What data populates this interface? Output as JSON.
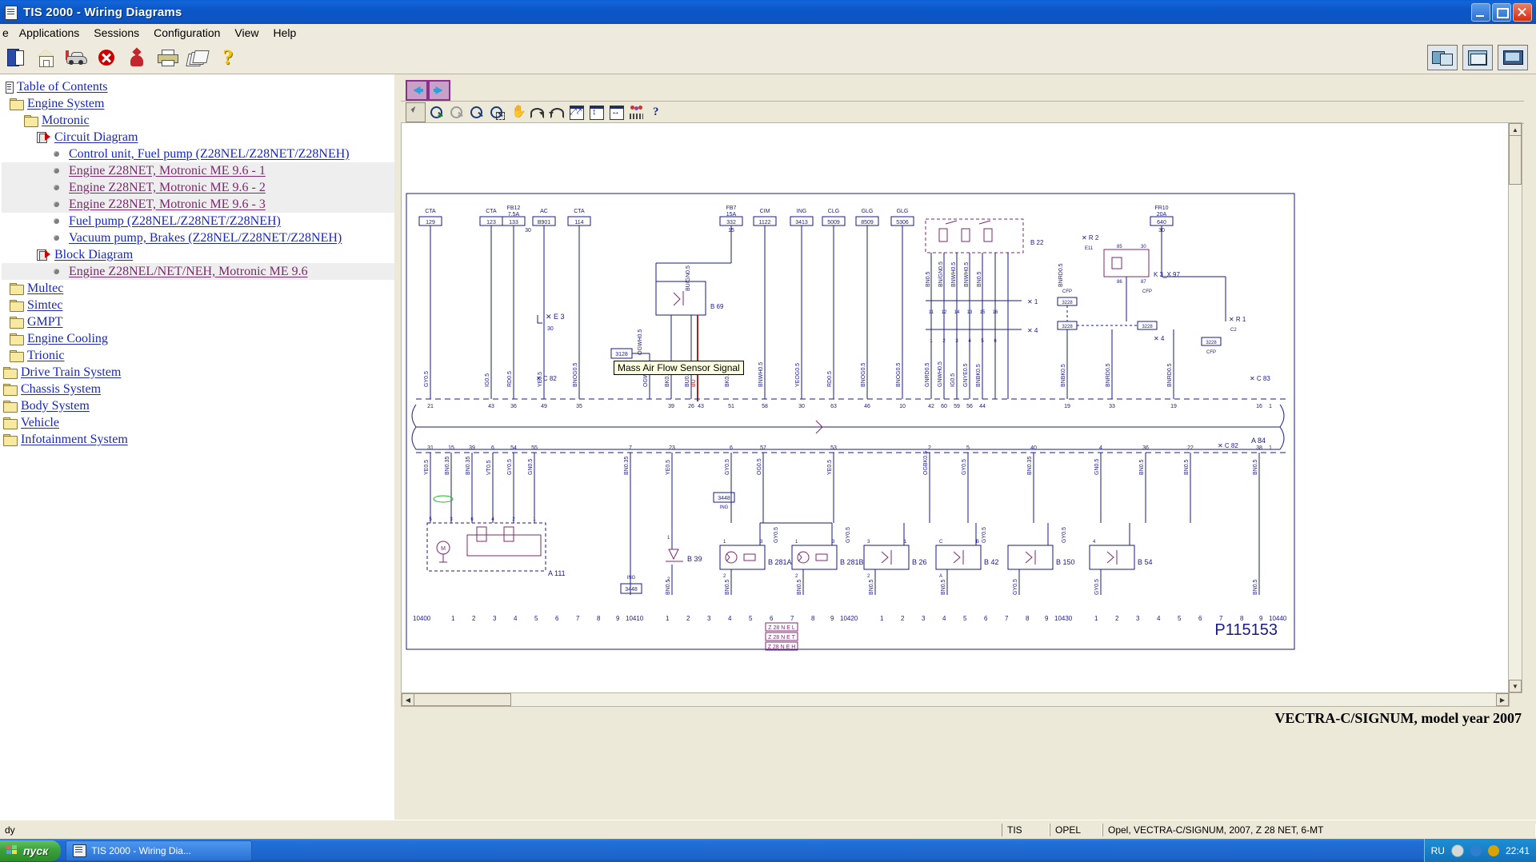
{
  "window": {
    "title": "TIS 2000 - Wiring Diagrams",
    "icon": "document-icon",
    "minimize": "minimize-icon",
    "maximize": "maximize-icon",
    "close": "close-icon"
  },
  "menubar": {
    "items": [
      {
        "label": "e",
        "name": "menu-file-clipped"
      },
      {
        "label": "Applications",
        "name": "menu-applications"
      },
      {
        "label": "Sessions",
        "name": "menu-sessions"
      },
      {
        "label": "Configuration",
        "name": "menu-configuration"
      },
      {
        "label": "View",
        "name": "menu-view"
      },
      {
        "label": "Help",
        "name": "menu-help"
      }
    ]
  },
  "toolbar": {
    "buttons": [
      {
        "name": "open-document-icon",
        "tip": "Open"
      },
      {
        "name": "home-icon",
        "tip": "Home"
      },
      {
        "name": "vehicle-icon",
        "tip": "Vehicle identification"
      },
      {
        "name": "stop-icon",
        "tip": "Stop"
      },
      {
        "name": "person-icon",
        "tip": "User"
      },
      {
        "name": "print-icon",
        "tip": "Print"
      },
      {
        "name": "pages-icon",
        "tip": "Documents"
      },
      {
        "name": "help-icon",
        "tip": "Help"
      }
    ],
    "right_buttons": [
      {
        "name": "window-tile-icon"
      },
      {
        "name": "window-cascade-icon"
      },
      {
        "name": "window-monitor-icon"
      }
    ]
  },
  "sidebar": {
    "items": [
      {
        "label": "Table of Contents",
        "indent": 0,
        "icon": "toc-icon",
        "visited": false
      },
      {
        "label": "Engine System",
        "indent": 1,
        "icon": "folder-icon",
        "visited": false
      },
      {
        "label": "Motronic",
        "indent": 2,
        "icon": "folder-icon",
        "visited": false
      },
      {
        "label": "Circuit Diagram",
        "indent": 3,
        "icon": "document-arrow-icon",
        "visited": false
      },
      {
        "label": "Control unit, Fuel pump (Z28NEL/Z28NET/Z28NEH)",
        "indent": 4,
        "icon": "bullet-icon",
        "visited": false
      },
      {
        "label": "Engine Z28NET, Motronic ME 9.6 - 1",
        "indent": 4,
        "icon": "bullet-icon",
        "visited": true
      },
      {
        "label": "Engine Z28NET, Motronic ME 9.6 - 2",
        "indent": 4,
        "icon": "bullet-icon",
        "visited": true
      },
      {
        "label": "Engine Z28NET, Motronic ME 9.6 - 3",
        "indent": 4,
        "icon": "bullet-icon",
        "visited": true
      },
      {
        "label": "Fuel pump (Z28NEL/Z28NET/Z28NEH)",
        "indent": 4,
        "icon": "bullet-icon",
        "visited": false
      },
      {
        "label": "Vacuum pump, Brakes (Z28NEL/Z28NET/Z28NEH)",
        "indent": 4,
        "icon": "bullet-icon",
        "visited": false
      },
      {
        "label": "Block Diagram",
        "indent": 3,
        "icon": "document-arrow-icon",
        "visited": false
      },
      {
        "label": "Engine Z28NEL/NET/NEH, Motronic ME 9.6",
        "indent": 4,
        "icon": "bullet-icon",
        "visited": true
      },
      {
        "label": "Multec",
        "indent": 2,
        "icon": "folder-icon",
        "visited": false
      },
      {
        "label": "Simtec",
        "indent": 2,
        "icon": "folder-icon",
        "visited": false
      },
      {
        "label": "GMPT",
        "indent": 2,
        "icon": "folder-icon",
        "visited": false
      },
      {
        "label": "Engine Cooling",
        "indent": 2,
        "icon": "folder-icon",
        "visited": false
      },
      {
        "label": "Trionic",
        "indent": 2,
        "icon": "folder-icon",
        "visited": false
      },
      {
        "label": "Drive Train System",
        "indent": 1,
        "icon": "folder-icon",
        "visited": false
      },
      {
        "label": "Chassis System",
        "indent": 1,
        "icon": "folder-icon",
        "visited": false
      },
      {
        "label": "Body System",
        "indent": 1,
        "icon": "folder-icon",
        "visited": false
      },
      {
        "label": "Vehicle",
        "indent": 1,
        "icon": "folder-icon",
        "visited": false
      },
      {
        "label": "Infotainment System",
        "indent": 1,
        "icon": "folder-icon",
        "visited": false
      }
    ]
  },
  "diagram_toolbar": {
    "nav": [
      {
        "name": "back-arrow-button"
      },
      {
        "name": "forward-arrow-button"
      }
    ],
    "tools": [
      {
        "name": "pointer-tool",
        "selected": true
      },
      {
        "name": "zoom-in-tool",
        "enabled": true
      },
      {
        "name": "zoom-out-tool",
        "enabled": false
      },
      {
        "name": "zoom-tool",
        "enabled": true
      },
      {
        "name": "zoom-region-tool",
        "enabled": true
      },
      {
        "name": "pan-hand-tool",
        "enabled": true
      },
      {
        "name": "rotate-cw-tool",
        "enabled": true
      },
      {
        "name": "rotate-ccw-tool",
        "enabled": true
      },
      {
        "name": "fit-page-tool",
        "enabled": true
      },
      {
        "name": "fit-height-tool",
        "enabled": true
      },
      {
        "name": "fit-width-tool",
        "enabled": true
      },
      {
        "name": "legend-tool",
        "enabled": true
      },
      {
        "name": "help-tool",
        "enabled": true
      }
    ]
  },
  "diagram": {
    "tooltip": "Mass Air Flow Sensor Signal",
    "drawing_number": "P115153",
    "caption": "VECTRA-C/SIGNUM, model year 2007",
    "fuses_top": [
      {
        "name": "CTA",
        "value": "129"
      },
      {
        "name": "CTA",
        "value": "123"
      },
      {
        "name": "FB12\n7.5A",
        "value": "133",
        "pin": "30"
      },
      {
        "name": "AC",
        "value": "B901"
      },
      {
        "name": "CTA",
        "value": "114"
      },
      {
        "name": "FB7\n15A",
        "value": "332",
        "pin": "15"
      },
      {
        "name": "CIM",
        "value": "1122"
      },
      {
        "name": "ING",
        "value": "3413"
      },
      {
        "name": "CLG",
        "value": "5009"
      },
      {
        "name": "GLG",
        "value": "8509"
      },
      {
        "name": "GLG",
        "value": "5306"
      },
      {
        "name": "FR10\n20A",
        "value": "640",
        "pin": "30"
      }
    ],
    "wire_labels_top": [
      "GY0.5",
      "IG0.5",
      "RD0.5",
      "YE0.5",
      "BN0.5",
      "OGWH0.5",
      "BK0.5",
      "BU0.5",
      "BK0.5",
      "BNWH0.5",
      "YEOG0.5",
      "RD0.5",
      "BNOG0.5",
      "GNRD0.5",
      "GNWH0.5",
      "IG0.5",
      "GNYE0.5",
      "BNBK0.5",
      "BNBK0.5",
      "BNRD0.5"
    ],
    "connectors": [
      "X E 3",
      "X C 82",
      "X C 83",
      "X 1",
      "X 4",
      "X R 2",
      "X R 1",
      "X 4"
    ],
    "components": [
      {
        "id": "B 69"
      },
      {
        "id": "B 22"
      },
      {
        "id": "K 3_X 97"
      },
      {
        "id": "A 84"
      },
      {
        "id": "A 111"
      },
      {
        "id": "B 39"
      },
      {
        "id": "B 281A"
      },
      {
        "id": "B 281B"
      },
      {
        "id": "B 26"
      },
      {
        "id": "B 42"
      },
      {
        "id": "B 150"
      },
      {
        "id": "B 54"
      }
    ],
    "ruler_groups": [
      "10400",
      "10410",
      "10420",
      "10430",
      "10440"
    ],
    "ruler_ticks": [
      "1",
      "2",
      "3",
      "4",
      "5",
      "6",
      "7",
      "8",
      "9"
    ],
    "footer_codes": [
      "Z 28 N E L",
      "Z 28 N E T",
      "Z 28 N E H"
    ],
    "bottom_wire_labels": [
      "YE0.5",
      "BN0.5",
      "BN0.5",
      "VT0.5",
      "GY0.5",
      "GN0.5",
      "BN0.5",
      "YE0.5",
      "GY0.5",
      "OG0.5",
      "GY0.5",
      "YE0.5",
      "OGBK0.5",
      "GY0.5",
      "BN0.5",
      "GN0.5",
      "BN0.5",
      "BN0.5",
      "GY0.5",
      "BN0.5"
    ],
    "boxes": [
      {
        "label": "3128",
        "sub": "AC"
      },
      {
        "label": "3448",
        "sub": "ING"
      },
      {
        "label": "3448",
        "sub": "ING"
      }
    ]
  },
  "statusbar": {
    "message": "dy",
    "cells": [
      "TIS",
      "OPEL",
      "Opel, VECTRA-C/SIGNUM, 2007, Z 28 NET, 6-MT"
    ]
  },
  "taskbar": {
    "start_label": "пуск",
    "items": [
      {
        "label": "TIS 2000 - Wiring Dia...",
        "icon": "tis-window-icon"
      }
    ],
    "tray": {
      "language": "RU",
      "icons": [
        "network-icon",
        "volume-icon",
        "shield-icon"
      ],
      "clock": "22:41"
    }
  },
  "colors": {
    "title_blue": "#0b57c8",
    "chrome": "#ece9d8",
    "link": "#1a27b8",
    "visited_link": "#7a2a6d",
    "diagram_ink": "#1a1a8a",
    "highlight_red": "#b02020"
  }
}
